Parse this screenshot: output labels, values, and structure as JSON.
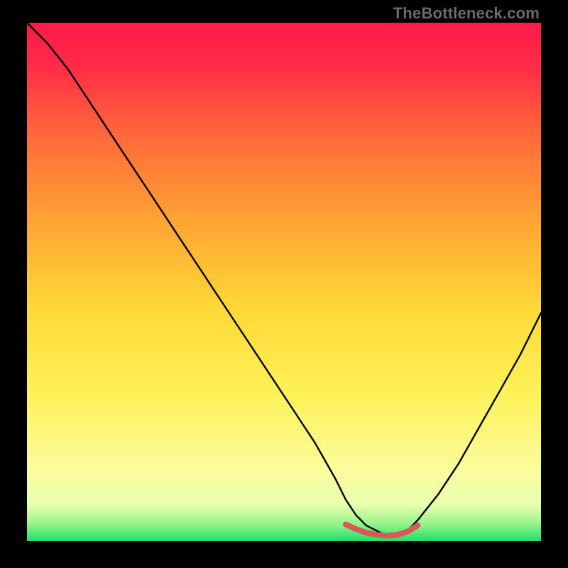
{
  "watermark": "TheBottleneck.com",
  "colors": {
    "gradient_top": "#ff1a4b",
    "gradient_mid_upper": "#ff8a2f",
    "gradient_mid": "#ffd836",
    "gradient_low": "#fff9a8",
    "gradient_bottom": "#1ee06a",
    "curve": "#000000",
    "highlight": "#d85a56",
    "frame": "#000000"
  },
  "chart_data": {
    "type": "line",
    "title": "",
    "xlabel": "",
    "ylabel": "",
    "xlim": [
      0,
      100
    ],
    "ylim": [
      0,
      100
    ],
    "series": [
      {
        "name": "bottleneck-curve",
        "x": [
          0,
          4,
          8,
          12,
          16,
          20,
          24,
          28,
          32,
          36,
          40,
          44,
          48,
          52,
          56,
          60,
          62,
          64,
          66,
          68,
          70,
          72,
          74,
          76,
          80,
          84,
          88,
          92,
          96,
          100
        ],
        "values": [
          100,
          96,
          91,
          85,
          79,
          73,
          67,
          61,
          55,
          49,
          43,
          37,
          31,
          25,
          19,
          12,
          8,
          5,
          3,
          2,
          1,
          1,
          2,
          4,
          9,
          15,
          22,
          29,
          36,
          44
        ]
      },
      {
        "name": "optimum-band",
        "x": [
          62,
          64,
          66,
          68,
          70,
          72,
          74,
          76
        ],
        "values": [
          3.2,
          2.3,
          1.6,
          1.2,
          1.0,
          1.2,
          1.8,
          3.0
        ]
      }
    ],
    "annotations": []
  }
}
